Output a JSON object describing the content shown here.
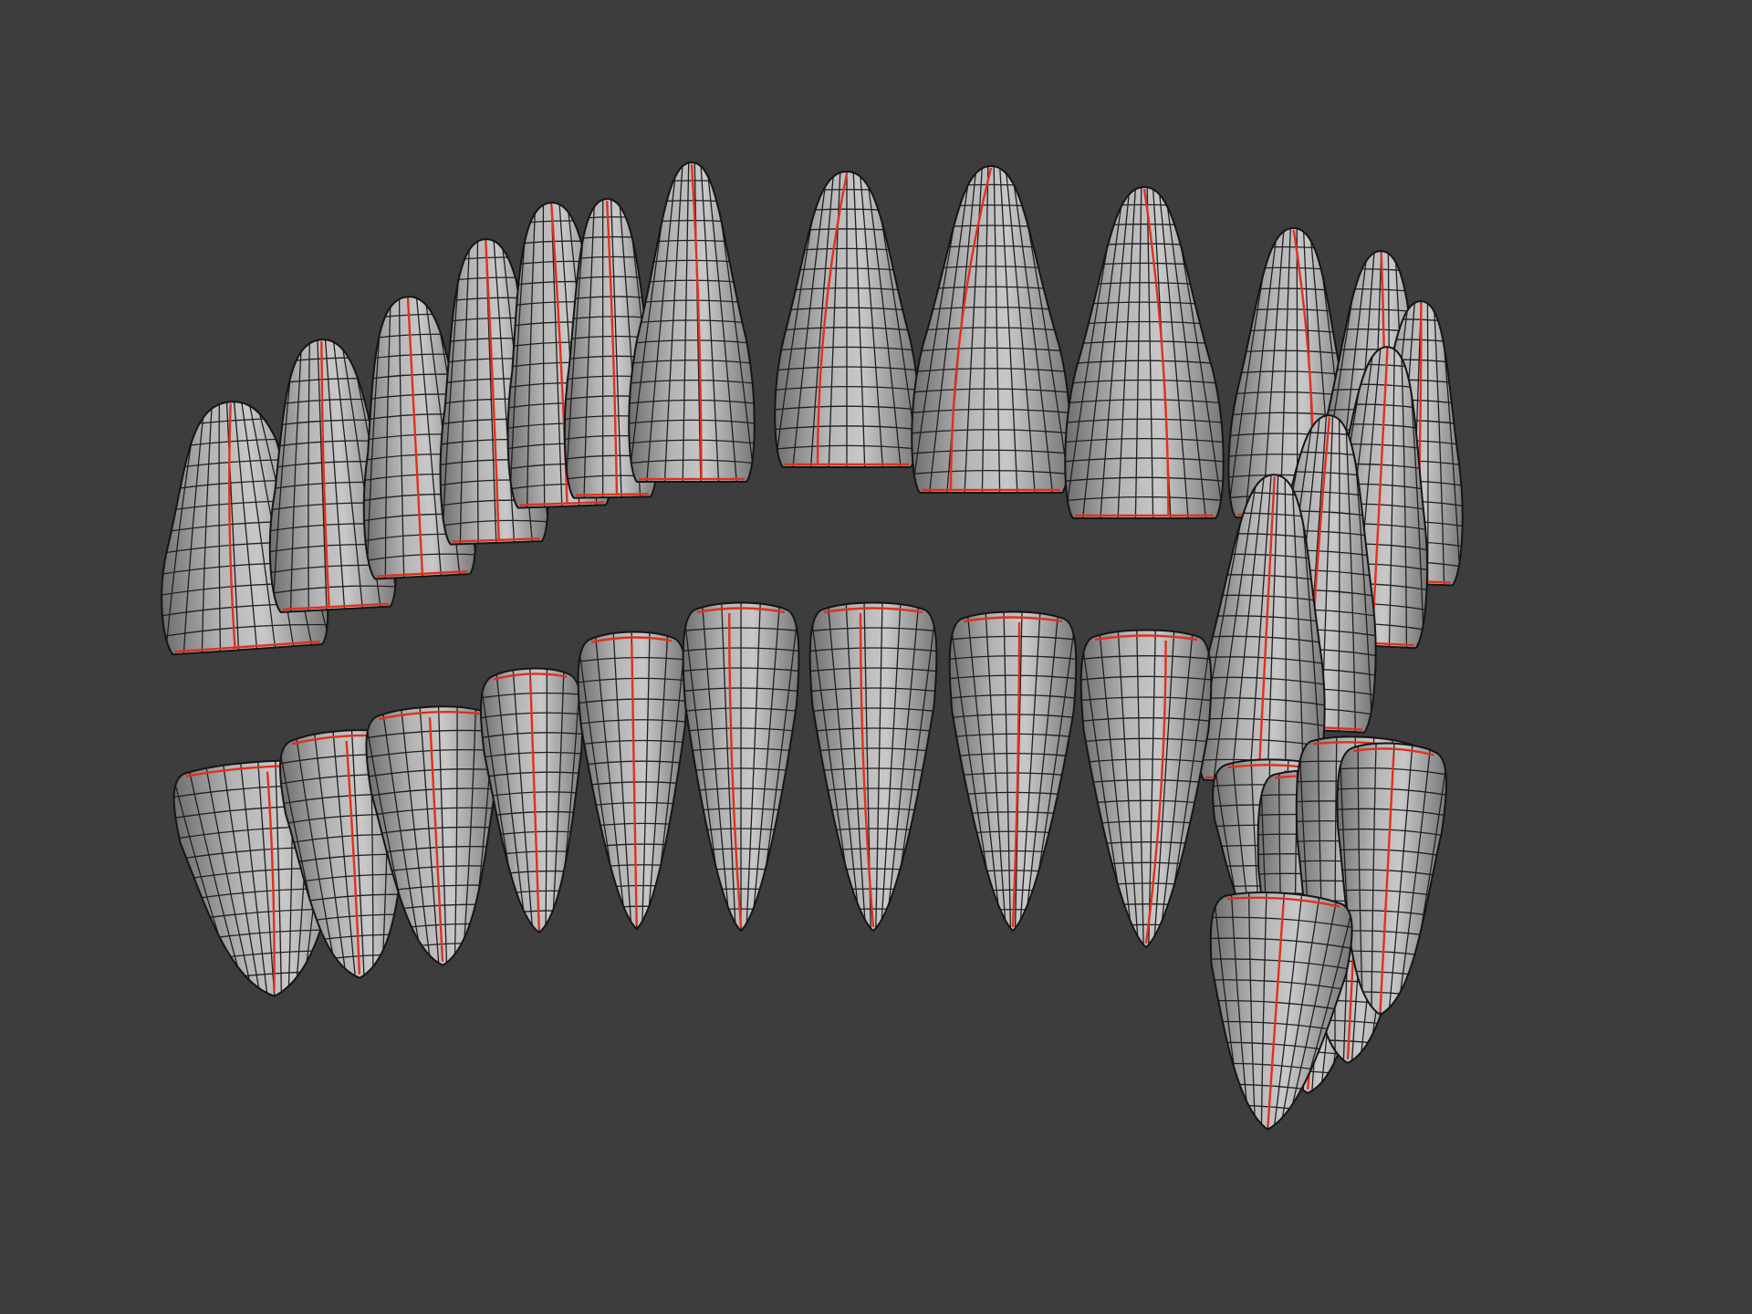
{
  "viewport": {
    "background": "#3d3d3d",
    "mode": "wireframe-on-shaded",
    "mesh_fill": "#a6a6a6",
    "mesh_fill_light": "#c4c4c4",
    "mesh_fill_dark": "#6e6e6e",
    "wire_color": "#1e1e1e",
    "seam_color": "#e0301e"
  },
  "model": {
    "subject": "full-dentition",
    "arches": [
      "upper-arch",
      "lower-arch"
    ]
  }
}
